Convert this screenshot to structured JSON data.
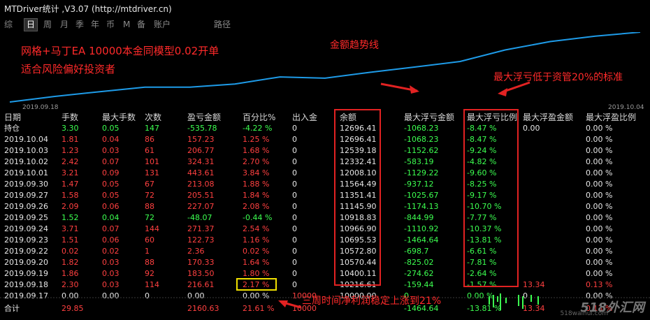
{
  "window": {
    "title": "MTDriver统计 ,V3.07 (http://mtdriver.cn)"
  },
  "toolbar": {
    "items": [
      "综",
      "日",
      "周",
      "月",
      "季",
      "年",
      "币",
      "M",
      "备",
      "账户",
      "路径"
    ],
    "active": "日"
  },
  "chart": {
    "start_date": "2019.09.18",
    "end_date": "2019.10.04",
    "line_color": "#1e9be8",
    "annotations": {
      "note1": "网格+马丁EA 10000本金同模型0.02开单",
      "note2": "适合风险偏好投资者",
      "trend": "金额趋势线",
      "drawdown": "最大浮亏低于资管20%的标准",
      "profit": "三周时间净利润稳定上涨到21%"
    }
  },
  "table": {
    "headers": [
      "日期",
      "手数",
      "最大手数",
      "次数",
      "盈亏金额",
      "百分比%",
      "出入金",
      "余额",
      "最大浮亏金额",
      "最大浮亏比例",
      "最大浮盈金额",
      "最大浮盈比例"
    ],
    "rows": [
      [
        "持仓",
        "3.30",
        "0.05",
        "147",
        "-535.78",
        "-4.22 %",
        "0",
        "12696.41",
        "-1068.23",
        "-8.47 %",
        "0.00",
        "0.00 %"
      ],
      [
        "2019.10.04",
        "1.81",
        "0.04",
        "86",
        "157.23",
        "1.25 %",
        "0",
        "12696.41",
        "-1068.23",
        "-8.47 %",
        "",
        "0.00 %"
      ],
      [
        "2019.10.03",
        "1.23",
        "0.03",
        "61",
        "206.77",
        "1.68 %",
        "0",
        "12539.18",
        "-1152.62",
        "-9.24 %",
        "",
        "0.00 %"
      ],
      [
        "2019.10.02",
        "2.42",
        "0.07",
        "101",
        "324.31",
        "2.70 %",
        "0",
        "12332.41",
        "-583.19",
        "-4.82 %",
        "",
        "0.00 %"
      ],
      [
        "2019.10.01",
        "3.21",
        "0.09",
        "131",
        "443.61",
        "3.84 %",
        "0",
        "12008.10",
        "-1129.22",
        "-9.60 %",
        "",
        "0.00 %"
      ],
      [
        "2019.09.30",
        "1.47",
        "0.05",
        "67",
        "213.08",
        "1.88 %",
        "0",
        "11564.49",
        "-937.12",
        "-8.25 %",
        "",
        "0.00 %"
      ],
      [
        "2019.09.27",
        "1.58",
        "0.05",
        "72",
        "205.51",
        "1.84 %",
        "0",
        "11351.41",
        "-1025.67",
        "-9.17 %",
        "",
        "0.00 %"
      ],
      [
        "2019.09.26",
        "2.09",
        "0.06",
        "88",
        "227.07",
        "2.08 %",
        "0",
        "11145.90",
        "-1174.13",
        "-10.70 %",
        "",
        "0.00 %"
      ],
      [
        "2019.09.25",
        "1.52",
        "0.04",
        "72",
        "-48.07",
        "-0.44 %",
        "0",
        "10918.83",
        "-844.99",
        "-7.77 %",
        "",
        "0.00 %"
      ],
      [
        "2019.09.24",
        "3.71",
        "0.07",
        "144",
        "271.37",
        "2.54 %",
        "0",
        "10966.90",
        "-1110.92",
        "-10.37 %",
        "",
        "0.00 %"
      ],
      [
        "2019.09.23",
        "1.51",
        "0.06",
        "60",
        "122.73",
        "1.16 %",
        "0",
        "10695.53",
        "-1464.64",
        "-13.81 %",
        "",
        "0.00 %"
      ],
      [
        "2019.09.22",
        "0.02",
        "0.02",
        "1",
        "2.36",
        "0.02 %",
        "0",
        "10572.80",
        "-698.7",
        "-6.61 %",
        "",
        "0.00 %"
      ],
      [
        "2019.09.20",
        "1.82",
        "0.03",
        "88",
        "170.33",
        "1.64 %",
        "0",
        "10570.44",
        "-825.02",
        "-7.81 %",
        "",
        "0.00 %"
      ],
      [
        "2019.09.19",
        "1.86",
        "0.03",
        "92",
        "183.50",
        "1.80 %",
        "0",
        "10400.11",
        "-274.62",
        "-2.64 %",
        "",
        "0.00 %"
      ],
      [
        "2019.09.18",
        "2.30",
        "0.03",
        "114",
        "216.61",
        "2.17 %",
        "0",
        "10216.61",
        "-159.44",
        "-1.57 %",
        "13.34",
        "0.13 %"
      ],
      [
        "2019.09.17",
        "0.00",
        "0.00",
        "0",
        "0.00",
        "0.00 %",
        "10000",
        "10000.00",
        "0",
        "0.00 %",
        "0",
        "0.00 %"
      ]
    ],
    "total": [
      "合计",
      "29.85",
      "",
      "",
      "2160.63",
      "21.61 %",
      "10000",
      "",
      "-1464.64",
      "-13.81 %",
      "13.34",
      "0.13 %"
    ]
  },
  "watermark": {
    "main": "518外汇网",
    "sub": "518waihui.com"
  },
  "colors": {
    "profit": "#ff4040",
    "loss": "#3cff50",
    "highlight_red": "#e22222",
    "highlight_yellow": "#f0e000"
  }
}
